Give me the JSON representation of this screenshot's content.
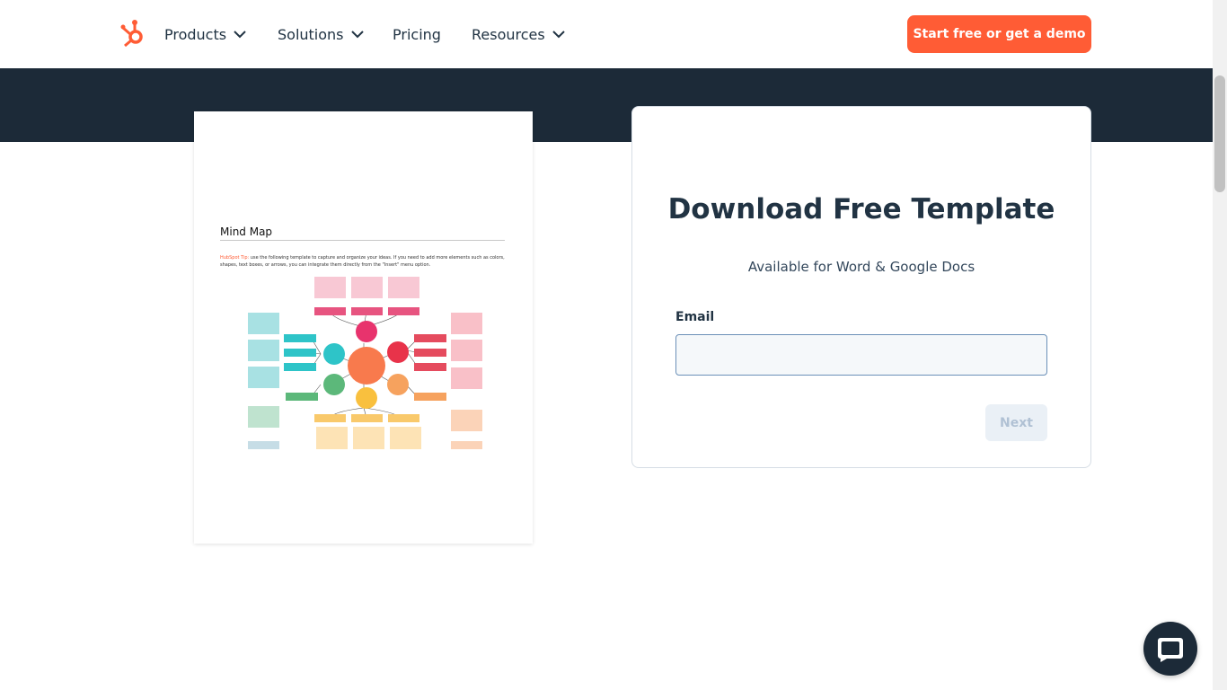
{
  "nav": {
    "items": [
      {
        "label": "Products",
        "dropdown": true
      },
      {
        "label": "Solutions",
        "dropdown": true
      },
      {
        "label": "Pricing",
        "dropdown": false
      },
      {
        "label": "Resources",
        "dropdown": true
      }
    ],
    "cta_label": "Start free or get a demo",
    "logo_icon": "hubspot-sprocket-icon"
  },
  "preview": {
    "doc_title": "Mind Map",
    "tip_label": "HubSpot Tip:",
    "tip_text": " use the following template to capture and organize your ideas. If you need to add more elements such as colors, shapes, text boxes, or arrows, you can integrate them directly from the \"Insert\" menu option."
  },
  "form": {
    "heading": "Download Free Template",
    "subheading": "Available for Word & Google Docs",
    "email_label": "Email",
    "email_value": "",
    "next_label": "Next"
  },
  "chat": {
    "icon": "chat-bubble-icon"
  },
  "colors": {
    "brand": "#ff5c35",
    "dark": "#1c2a38",
    "text": "#213343"
  }
}
